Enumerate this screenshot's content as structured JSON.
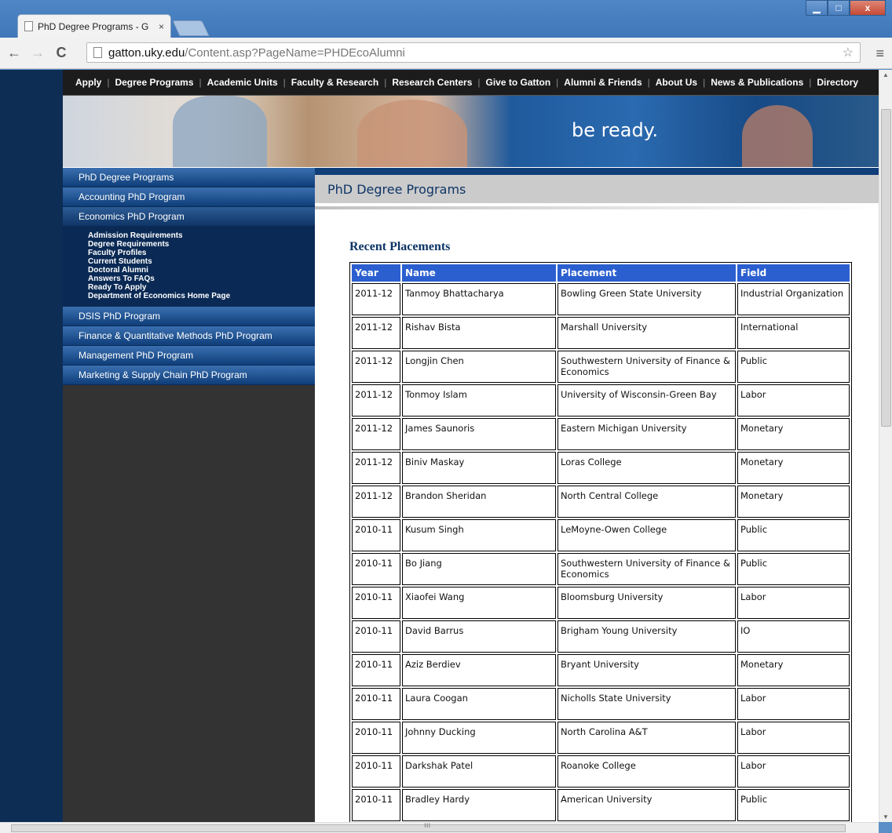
{
  "browser": {
    "tab_title": "PhD Degree Programs - G",
    "tab_close": "×",
    "url_host": "gatton.uky.edu",
    "url_path": "/Content.asp?PageName=PHDEcoAlumni",
    "back": "←",
    "forward": "→",
    "reload": "C",
    "star": "☆",
    "menu": "≡",
    "minimize": "▁",
    "maximize": "□",
    "close": "x"
  },
  "topnav": [
    "Apply",
    "Degree Programs",
    "Academic Units",
    "Faculty & Research",
    "Research Centers",
    "Give to Gatton",
    "Alumni & Friends",
    "About Us",
    "News & Publications",
    "Directory"
  ],
  "banner": {
    "tagline": "be ready."
  },
  "leftnav": {
    "top_items": [
      "PhD Degree Programs",
      "Accounting PhD Program",
      "Economics PhD Program"
    ],
    "sub_items": [
      "Admission Requirements",
      "Degree Requirements",
      "Faculty Profiles",
      "Current Students",
      "Doctoral Alumni",
      "Answers To FAQs",
      "Ready To Apply",
      "Department of Economics Home Page"
    ],
    "bottom_items": [
      "DSIS PhD Program",
      "Finance & Quantitative Methods PhD Program",
      "Management PhD Program",
      "Marketing & Supply Chain PhD Program"
    ]
  },
  "content": {
    "title": "PhD Degree Programs",
    "section_title": "Recent Placements",
    "table": {
      "headers": [
        "Year",
        "Name",
        "Placement",
        "Field"
      ],
      "rows": [
        [
          "2011-12",
          "Tanmoy Bhattacharya",
          "Bowling Green State University",
          "Industrial Organization"
        ],
        [
          "2011-12",
          "Rishav Bista",
          " Marshall University",
          "International"
        ],
        [
          "2011-12",
          "Longjin Chen",
          " Southwestern University of Finance & Economics",
          "Public"
        ],
        [
          "2011-12",
          "Tonmoy Islam",
          "University of Wisconsin-Green Bay",
          "Labor"
        ],
        [
          "2011-12",
          "James Saunoris",
          "Eastern Michigan University",
          "Monetary"
        ],
        [
          "2011-12",
          "Biniv Maskay",
          "Loras College",
          "Monetary"
        ],
        [
          "2011-12",
          "Brandon Sheridan",
          "North Central College",
          "Monetary"
        ],
        [
          "2010-11",
          "Kusum Singh",
          "LeMoyne-Owen College",
          "Public"
        ],
        [
          "2010-11",
          "Bo Jiang",
          " Southwestern University of Finance & Economics",
          "Public"
        ],
        [
          "2010-11",
          "Xiaofei Wang",
          "Bloomsburg University",
          "Labor"
        ],
        [
          "2010-11",
          "David Barrus",
          "Brigham Young University",
          "IO"
        ],
        [
          "2010-11",
          "Aziz Berdiev",
          "Bryant University",
          "Monetary"
        ],
        [
          "2010-11",
          "Laura Coogan",
          "Nicholls State University",
          "Labor"
        ],
        [
          "2010-11",
          "Johnny Ducking",
          "North Carolina A&T",
          "Labor"
        ],
        [
          "2010-11",
          "Darkshak Patel",
          "Roanoke College",
          "Labor"
        ],
        [
          "2010-11",
          "Bradley Hardy",
          "American University",
          "Public"
        ]
      ]
    }
  }
}
